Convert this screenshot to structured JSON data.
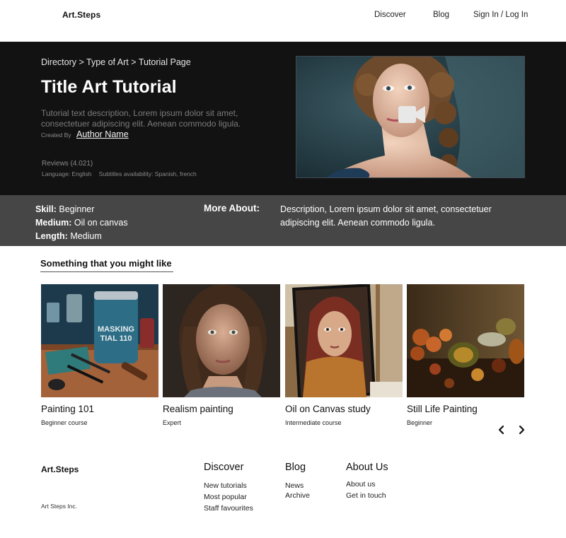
{
  "header": {
    "logo": "Art.Steps",
    "nav": [
      "Discover",
      "Blog",
      "Sign In / Log In"
    ]
  },
  "hero": {
    "breadcrumb": "Directory > Type of Art > Tutorial Page",
    "title": "Title Art Tutorial",
    "description": "Tutorial text description, Lorem ipsum dolor sit amet, consectetuer adipiscing elit. Aenean commodo ligula.",
    "created_by_label": "Created By",
    "author": "Author Name",
    "reviews": "Reviews (4.021)",
    "language": "Language: English",
    "subtitles": "Subtitles availability: Spanish, french",
    "video_icon": "video-camera-icon"
  },
  "info": {
    "skill_label": "Skill:",
    "skill_value": "Beginner",
    "medium_label": "Medium:",
    "medium_value": "Oil on canvas",
    "length_label": "Length:",
    "length_value": "Medium",
    "more_label": "More About:",
    "more_desc": "Description, Lorem ipsum dolor sit amet, consectetuer adipiscing elit. Aenean commodo ligula."
  },
  "recommendations": {
    "title": "Something that you might like",
    "cards": [
      {
        "title": "Painting 101",
        "subtitle": "Beginner course",
        "jar_label_1": "MASKING",
        "jar_label_2": "TIAL 110"
      },
      {
        "title": "Realism painting",
        "subtitle": "Expert"
      },
      {
        "title": "Oil on Canvas study",
        "subtitle": "Intermediate course"
      },
      {
        "title": "Still Life Painting",
        "subtitle": "Beginner"
      }
    ],
    "prev_icon": "chevron-left-icon",
    "next_icon": "chevron-right-icon"
  },
  "footer": {
    "logo": "Art.Steps",
    "company": "Art Steps Inc.",
    "columns": [
      {
        "heading": "Discover",
        "links": [
          "New tutorials",
          "Most popular",
          "Staff favourites"
        ]
      },
      {
        "heading": "Blog",
        "links": [
          "News",
          "Archive"
        ]
      },
      {
        "heading": "About Us",
        "links": [
          "About us",
          "Get in touch"
        ]
      }
    ]
  },
  "colors": {
    "hero_bg": "#121212",
    "band_bg": "#464646",
    "page_bg": "#ffffff"
  }
}
